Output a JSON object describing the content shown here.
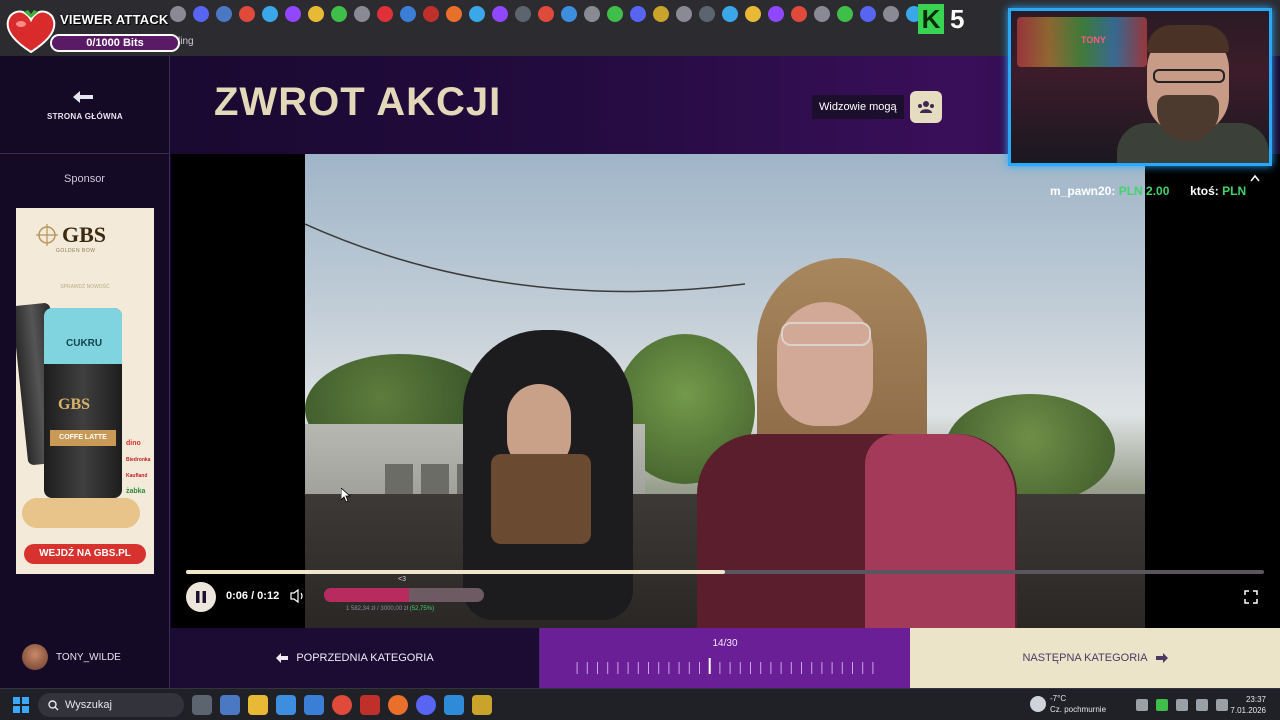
{
  "overlay": {
    "viewer_attack_title": "VIEWER ATTACK",
    "bits_progress": "0/1000 Bits",
    "bits_fraction": 0,
    "brand_badge": "5"
  },
  "browser": {
    "tab_fragment": "ling"
  },
  "sidebar": {
    "home_label": "STRONA GŁÓWNA",
    "sponsor_label": "Sponsor",
    "ad": {
      "brand": "GBS",
      "brand_sub": "GOLDEN BOW",
      "promo_text": "SPRAWDŹ NOWOŚĆ",
      "can_label": "CUKRU",
      "flavor": "COFFE LATTE",
      "shops": [
        "dino",
        "Biedronka",
        "Kaufland",
        "żabka"
      ],
      "cta": "WEJDŹ NA GBS.PL"
    }
  },
  "header": {
    "title": "ZWROT AKCJI",
    "viewers_label": "Widzowie mogą"
  },
  "player": {
    "time_display": "0:06 / 0:12",
    "progress_fraction": 0.5,
    "donation_fraction": 0.53,
    "donation_text": "1 582,34 zł / 3000,00 zł",
    "donation_percent": "(52,75%)",
    "donation_marker": "<3"
  },
  "alerts": [
    {
      "user": "m_pawn20:",
      "amount": "PLN 2.00"
    },
    {
      "user": "ktoś:",
      "amount": "PLN"
    }
  ],
  "webcam": {
    "sign": "TONY"
  },
  "bottom_nav": {
    "username": "TONY_WILDE",
    "prev_label": "POPRZEDNIA KATEGORIA",
    "pager": "14/30",
    "current_index": 14,
    "total": 30,
    "next_label": "NASTĘPNA KATEGORIA"
  },
  "taskbar": {
    "search_placeholder": "Wyszukaj",
    "weather_temp": "-7°C",
    "weather_desc": "Cz. pochmurnie",
    "time": "23:37",
    "date": "7.01.2026"
  },
  "colors": {
    "accent_cream": "#e3d9b9",
    "pager_purple": "#6a1f97",
    "alert_green": "#43d36c",
    "webcam_border": "#29a8ff"
  }
}
